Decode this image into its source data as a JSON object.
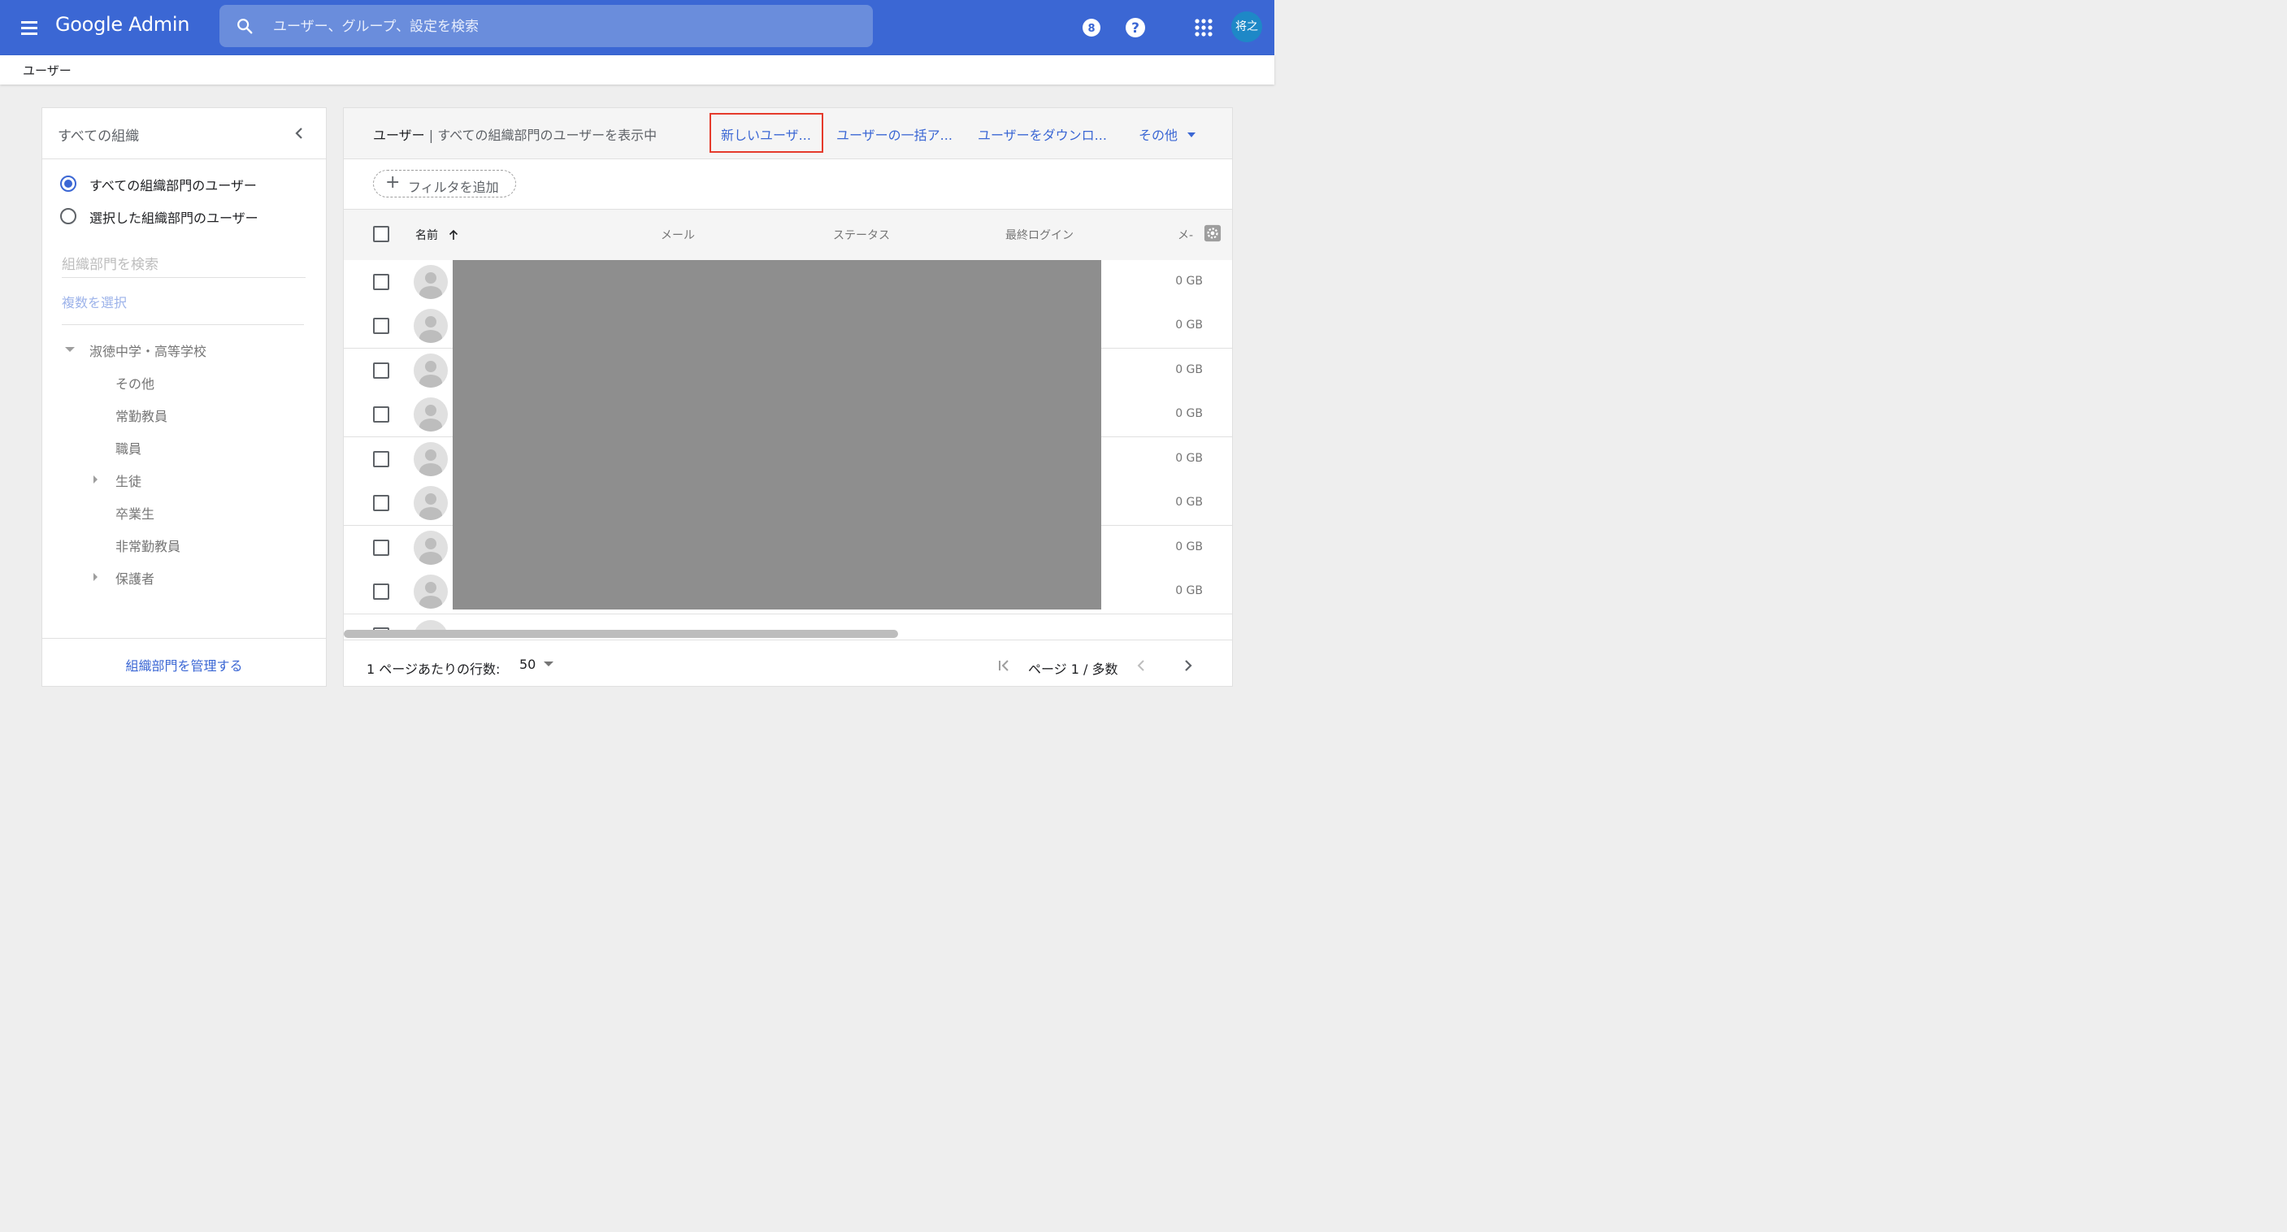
{
  "topbar": {
    "product": "Google Admin",
    "search_placeholder": "ユーザー、グループ、設定を検索",
    "timer_badge": "8",
    "avatar_initials": "将之"
  },
  "breadcrumb": "ユーザー",
  "sidebar": {
    "title": "すべての組織",
    "radio_all": "すべての組織部門のユーザー",
    "radio_selected": "選択した組織部門のユーザー",
    "org_search_placeholder": "組織部門を検索",
    "multi_select": "複数を選択",
    "tree": [
      {
        "label": "淑徳中学・高等学校",
        "expander": "down"
      },
      {
        "label": "その他",
        "expander": "none"
      },
      {
        "label": "常勤教員",
        "expander": "none"
      },
      {
        "label": "職員",
        "expander": "none"
      },
      {
        "label": "生徒",
        "expander": "right"
      },
      {
        "label": "卒業生",
        "expander": "none"
      },
      {
        "label": "非常勤教員",
        "expander": "none"
      },
      {
        "label": "保護者",
        "expander": "right"
      }
    ],
    "manage_link": "組織部門を管理する"
  },
  "main": {
    "title": "ユーザー",
    "title_sep": " | ",
    "subtitle": "すべての組織部門のユーザーを表示中",
    "actions": {
      "new_user": "新しいユーザ...",
      "bulk": "ユーザーの一括ア...",
      "download": "ユーザーをダウンロ...",
      "more": "その他"
    },
    "filter_label": "フィルタを追加",
    "columns": {
      "name": "名前",
      "email": "メール",
      "status": "ステータス",
      "last_login": "最終ログイン",
      "storage": "メ-"
    },
    "rows": [
      {
        "storage": "0 GB"
      },
      {
        "storage": "0 GB"
      },
      {
        "storage": "0 GB"
      },
      {
        "storage": "0 GB"
      },
      {
        "storage": "0 GB"
      },
      {
        "storage": "0 GB"
      },
      {
        "storage": "0 GB"
      },
      {
        "storage": "0 GB"
      }
    ],
    "pager": {
      "rows_per_page_label": "1 ページあたりの行数:",
      "rows_per_page": "50",
      "page_text": "ページ 1 / 多数"
    }
  },
  "colors": {
    "brand_blue": "#3b67d4",
    "highlight_red": "#e53b2c"
  }
}
